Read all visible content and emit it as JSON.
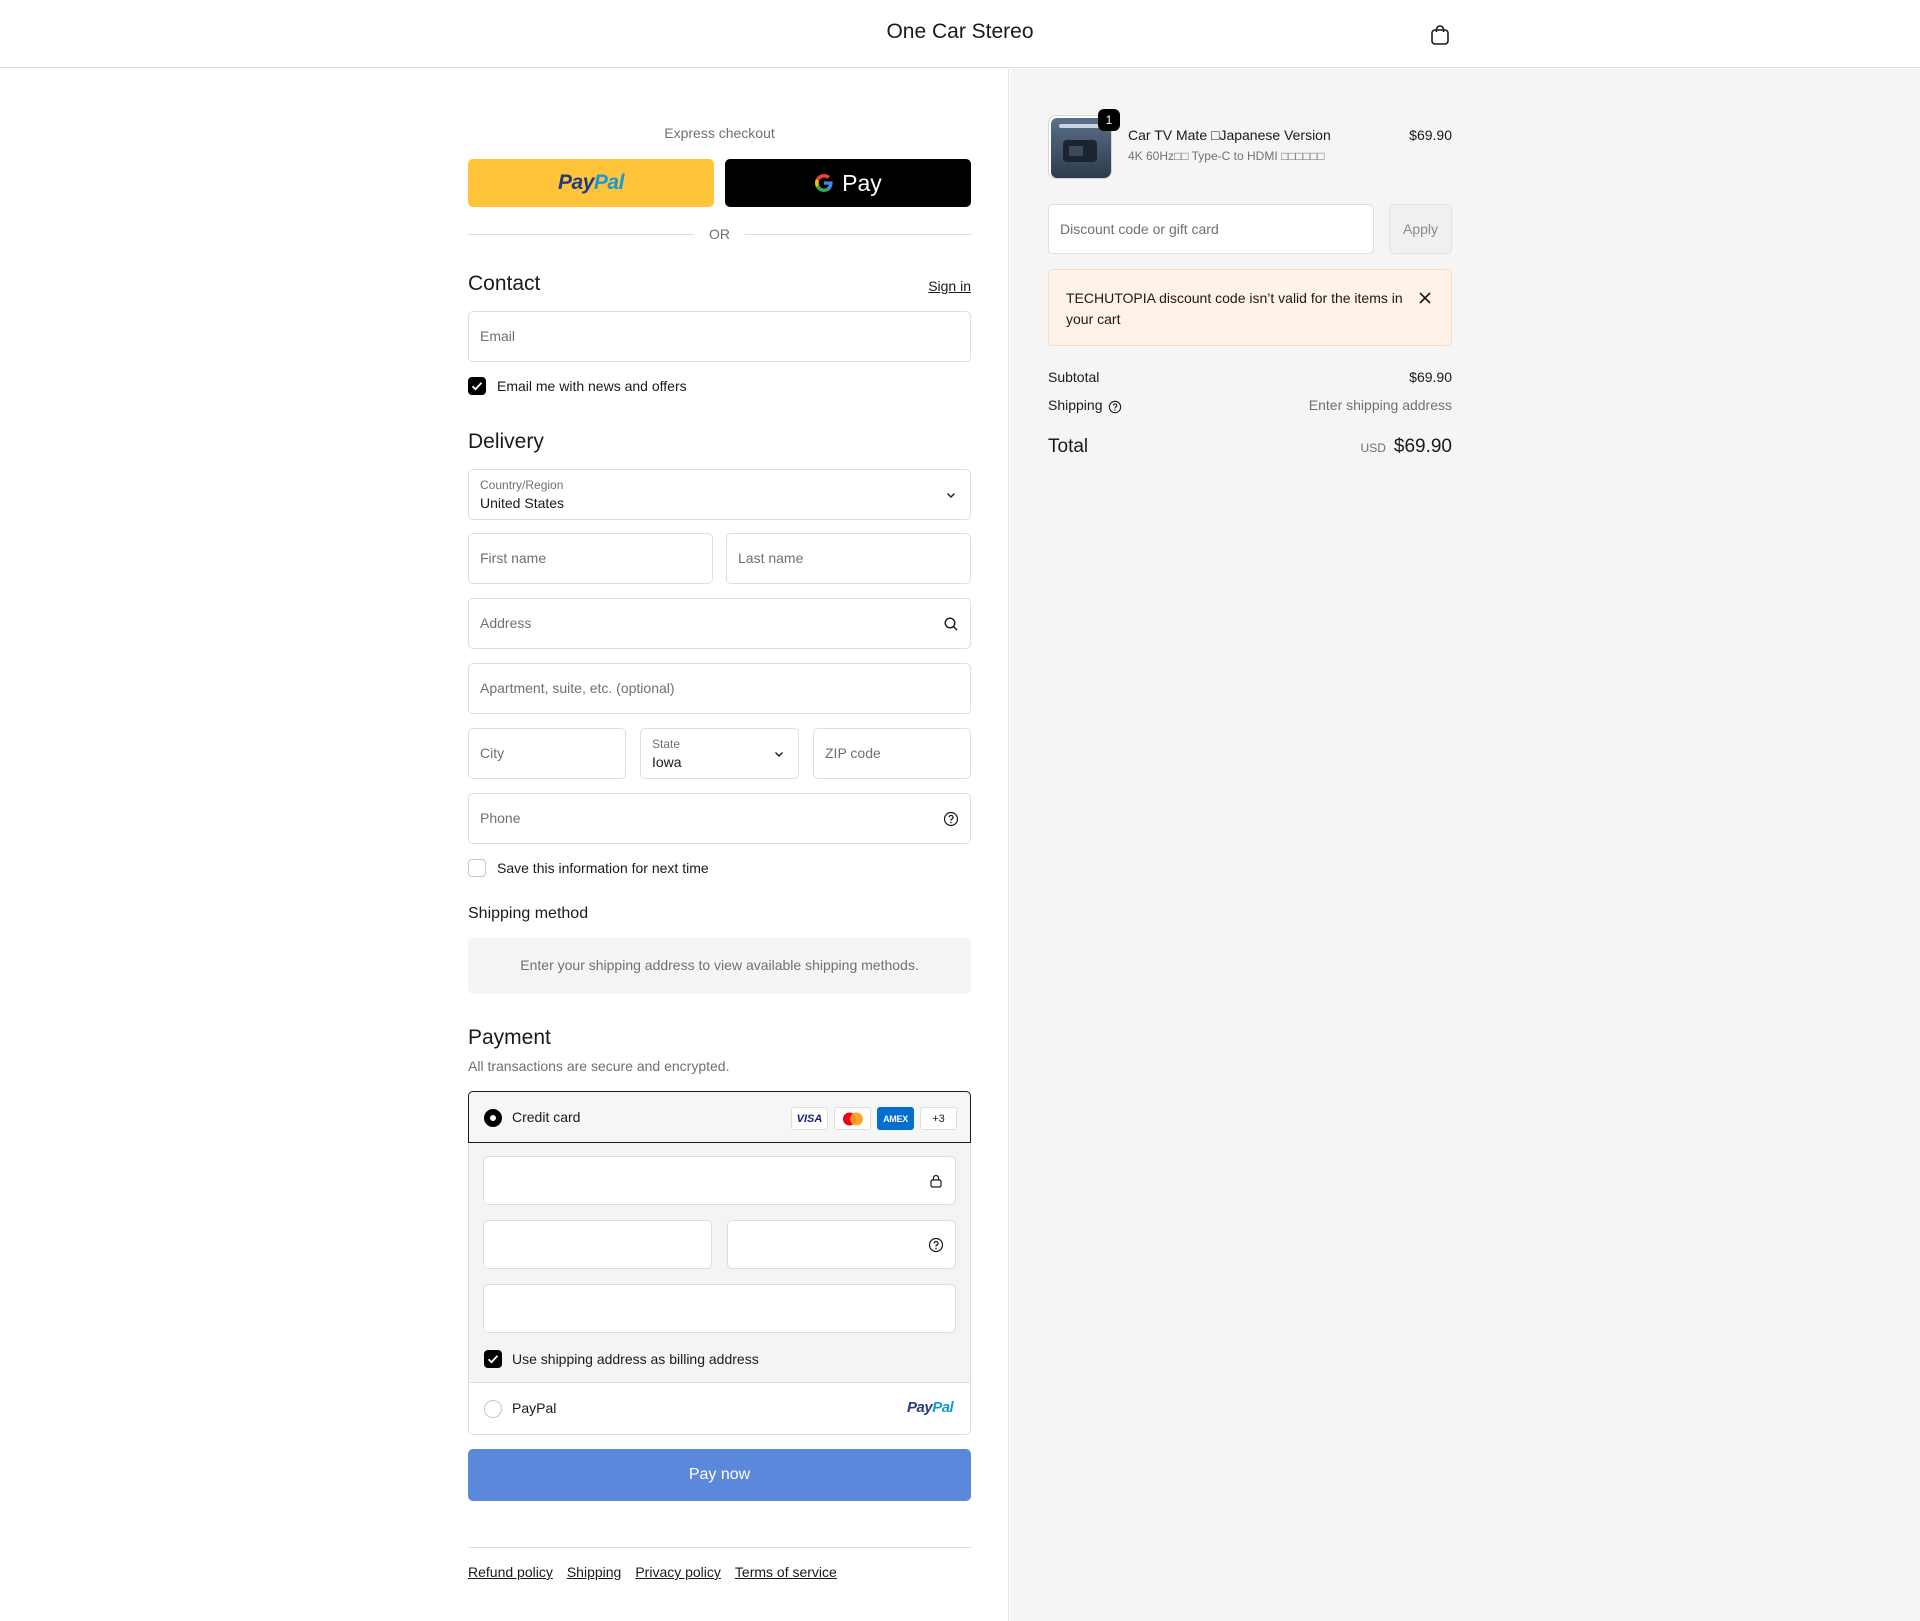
{
  "header": {
    "store_name": "One Car Stereo"
  },
  "express": {
    "title": "Express checkout",
    "paypal_label_1": "Pay",
    "paypal_label_2": "Pal",
    "gpay_label": "Pay",
    "or_label": "OR"
  },
  "contact": {
    "title": "Contact",
    "sign_in": "Sign in",
    "email_placeholder": "Email",
    "news_label": "Email me with news and offers",
    "news_checked": true
  },
  "delivery": {
    "title": "Delivery",
    "country_label": "Country/Region",
    "country_value": "United States",
    "first_name_placeholder": "First name",
    "last_name_placeholder": "Last name",
    "address_placeholder": "Address",
    "apartment_placeholder": "Apartment, suite, etc. (optional)",
    "city_placeholder": "City",
    "state_label": "State",
    "state_value": "Iowa",
    "zip_placeholder": "ZIP code",
    "phone_placeholder": "Phone",
    "save_label": "Save this information for next time",
    "save_checked": false
  },
  "shipping_method": {
    "title": "Shipping method",
    "message": "Enter your shipping address to view available shipping methods."
  },
  "payment": {
    "title": "Payment",
    "subtitle": "All transactions are secure and encrypted.",
    "credit_card_label": "Credit card",
    "card_brands": [
      "VISA",
      "mastercard",
      "AMEX",
      "+3"
    ],
    "billing_label": "Use shipping address as billing address",
    "billing_checked": true,
    "paypal_option_label": "PayPal",
    "paypal_logo_1": "Pay",
    "paypal_logo_2": "Pal",
    "pay_now_label": "Pay now"
  },
  "footer": {
    "links": [
      "Refund policy",
      "Shipping",
      "Privacy policy",
      "Terms of service"
    ]
  },
  "summary": {
    "product": {
      "name": "Car TV Mate □Japanese Version",
      "variant": "4K 60Hz□□ Type-C to HDMI □□□□□□",
      "price": "$69.90",
      "quantity": "1"
    },
    "discount_placeholder": "Discount code or gift card",
    "apply_label": "Apply",
    "alert_text": "TECHUTOPIA discount code isn’t valid for the items in your cart",
    "subtotal_label": "Subtotal",
    "subtotal_value": "$69.90",
    "shipping_label": "Shipping",
    "shipping_value": "Enter shipping address",
    "total_label": "Total",
    "currency": "USD",
    "total_value": "$69.90"
  },
  "colors": {
    "paypal_yellow": "#ffc439",
    "paypal_dark_blue": "#253b80",
    "paypal_light_blue": "#179bd7",
    "pay_now_blue": "#5b88db",
    "alert_bg": "#fff3e9"
  }
}
